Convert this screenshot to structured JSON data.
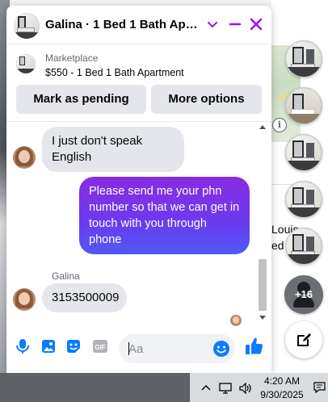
{
  "chat": {
    "title": "Galina · 1 Bed 1 Bath Apart...",
    "listing": {
      "source": "Marketplace",
      "title": "$550 - 1 Bed 1 Bath Apartment"
    },
    "actions": {
      "mark_pending": "Mark as pending",
      "more_options": "More options"
    },
    "messages": [
      {
        "direction": "in",
        "text": "I just don't speak English"
      },
      {
        "direction": "out",
        "text": "Please send me your phn number so that we can get in touch with you through phone"
      },
      {
        "direction": "in",
        "sender": "Galina",
        "text": "3153500009"
      }
    ],
    "composer": {
      "placeholder": "Aa"
    }
  },
  "background": {
    "fragment_1": "Louis",
    "fragment_2": "ed"
  },
  "chat_heads": {
    "more_count": "+16"
  },
  "taskbar": {
    "time": "4:20 AM",
    "date": "9/30/2025"
  },
  "colors": {
    "accent": "#a20cf2",
    "outgoing_bubble_start": "#8a2be2",
    "outgoing_bubble_end": "#4f5af5",
    "incoming_bubble": "#e4e6eb",
    "like_blue": "#0a7cff"
  }
}
